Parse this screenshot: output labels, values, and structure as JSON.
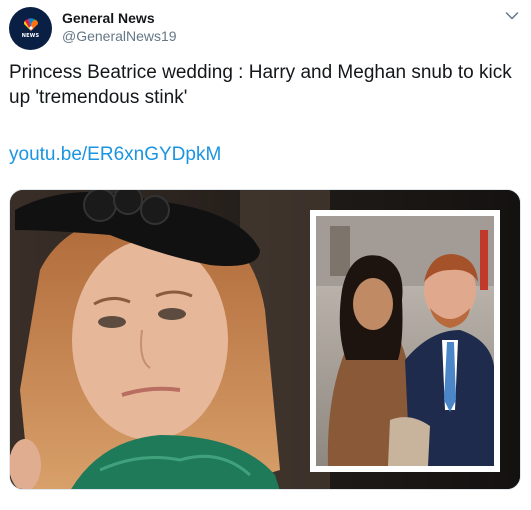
{
  "account": {
    "display_name": "General News",
    "handle": "@GeneralNews19",
    "avatar_icon": "peacock-news-logo-icon",
    "avatar_text": "NEWS",
    "avatar_color": "#0a1f44"
  },
  "tweet": {
    "text": "Princess Beatrice wedding : Harry and Meghan snub to kick up 'tremendous stink'",
    "link": "youtu.be/ER6xnGYDpkM",
    "link_color": "#1b95e0"
  },
  "menu": {
    "icon": "chevron-down-icon"
  },
  "media": {
    "description_icon": "photo-thumbnail"
  }
}
